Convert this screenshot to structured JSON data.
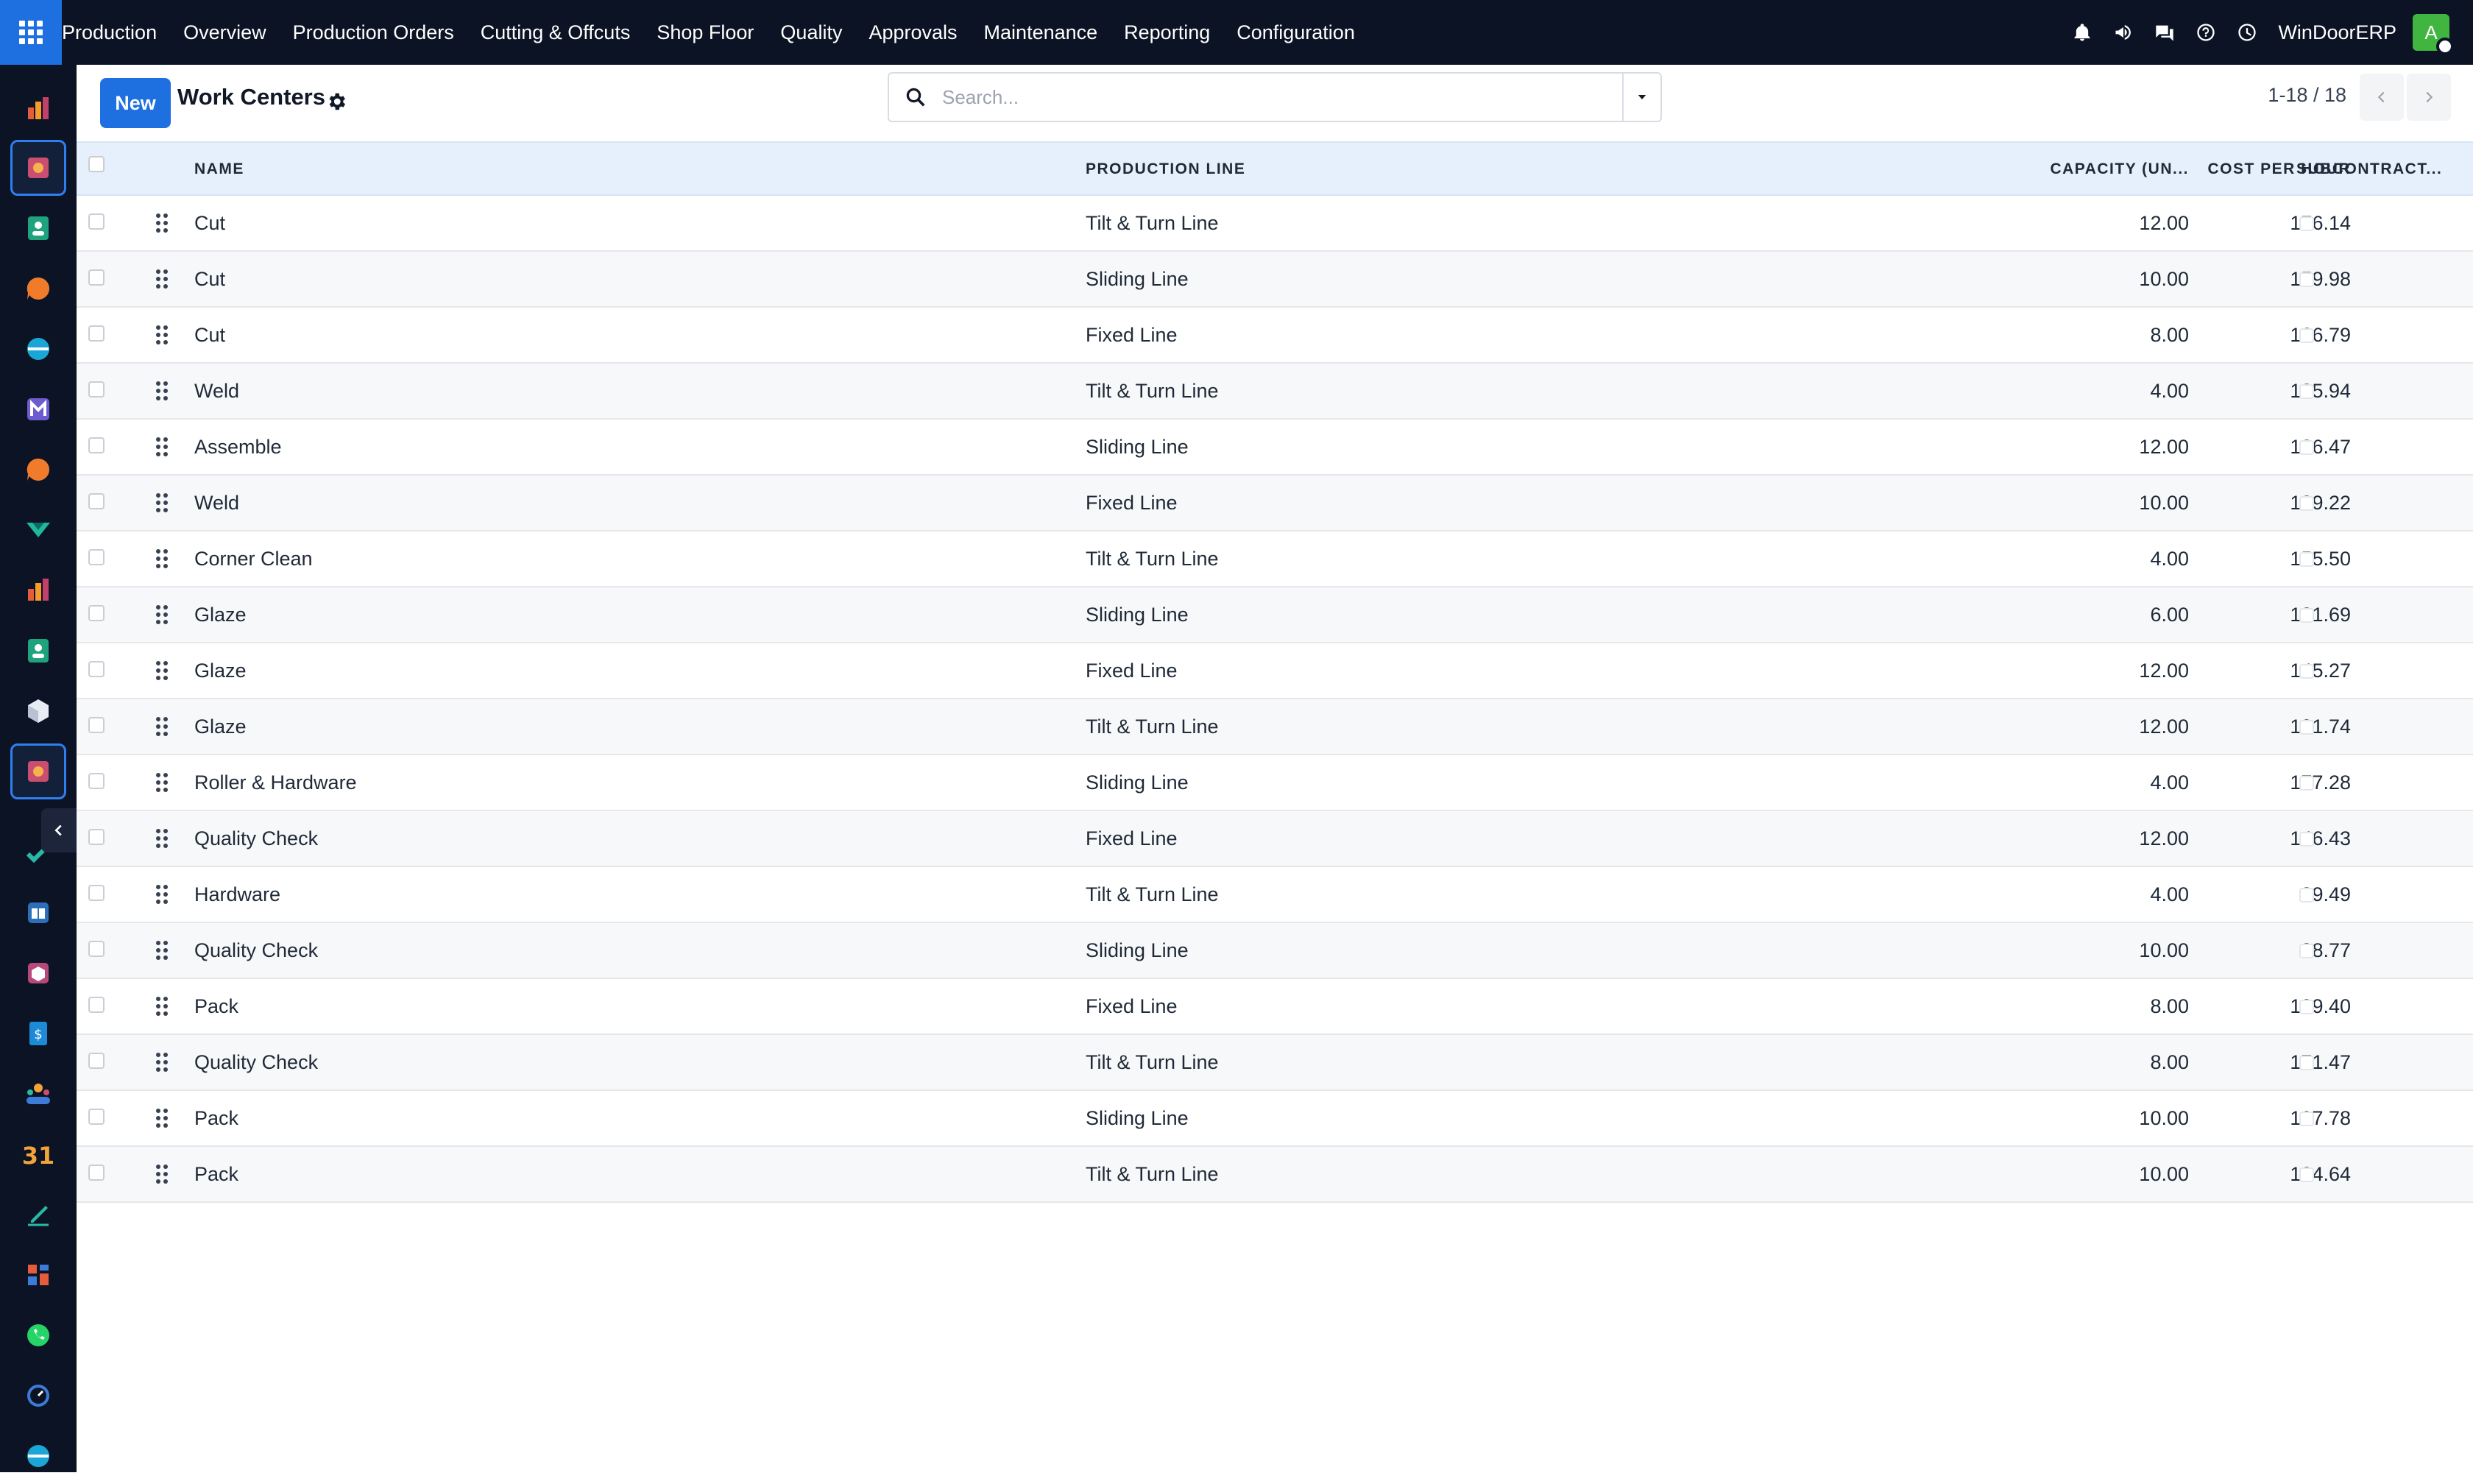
{
  "topbar": {
    "brand": "Production",
    "menu": [
      "Overview",
      "Production Orders",
      "Cutting & Offcuts",
      "Shop Floor",
      "Quality",
      "Approvals",
      "Maintenance",
      "Reporting",
      "Configuration"
    ],
    "company": "WinDoorERP",
    "avatar_initial": "A",
    "icons": [
      "bell-icon",
      "megaphone-icon",
      "chat-icon",
      "help-icon",
      "clock-icon"
    ]
  },
  "sidebar": {
    "apps": [
      "dashboards-app",
      "manufacturing-app",
      "contacts-app",
      "discuss-app",
      "planning-app",
      "mail-app",
      "discuss-app",
      "inventory-app",
      "dashboards-app",
      "contacts-app",
      "packages-app",
      "manufacturing-app",
      "project-app",
      "knowledge-app",
      "product-app",
      "invoicing-app",
      "employees-app",
      "calendar-app",
      "sign-app",
      "apps-dashboard-app",
      "whatsapp-app",
      "clock-app",
      "planning-app"
    ]
  },
  "control": {
    "new_label": "New",
    "title": "Work Centers",
    "search_placeholder": "Search...",
    "pager": "1-18 / 18"
  },
  "table": {
    "columns": {
      "name": "NAME",
      "line": "PRODUCTION LINE",
      "capacity": "CAPACITY (UN...",
      "cost": "COST PER HOUR",
      "subcontract": "SUBCONTRACT..."
    },
    "rows": [
      {
        "name": "Cut",
        "line": "Tilt & Turn Line",
        "capacity": "12.00",
        "cost": "176.14"
      },
      {
        "name": "Cut",
        "line": "Sliding Line",
        "capacity": "10.00",
        "cost": "159.98"
      },
      {
        "name": "Cut",
        "line": "Fixed Line",
        "capacity": "8.00",
        "cost": "166.79"
      },
      {
        "name": "Weld",
        "line": "Tilt & Turn Line",
        "capacity": "4.00",
        "cost": "125.94"
      },
      {
        "name": "Assemble",
        "line": "Sliding Line",
        "capacity": "12.00",
        "cost": "126.47"
      },
      {
        "name": "Weld",
        "line": "Fixed Line",
        "capacity": "10.00",
        "cost": "129.22"
      },
      {
        "name": "Corner Clean",
        "line": "Tilt & Turn Line",
        "capacity": "4.00",
        "cost": "155.50"
      },
      {
        "name": "Glaze",
        "line": "Sliding Line",
        "capacity": "6.00",
        "cost": "131.69"
      },
      {
        "name": "Glaze",
        "line": "Fixed Line",
        "capacity": "12.00",
        "cost": "145.27"
      },
      {
        "name": "Glaze",
        "line": "Tilt & Turn Line",
        "capacity": "12.00",
        "cost": "101.74"
      },
      {
        "name": "Roller & Hardware",
        "line": "Sliding Line",
        "capacity": "4.00",
        "cost": "177.28"
      },
      {
        "name": "Quality Check",
        "line": "Fixed Line",
        "capacity": "12.00",
        "cost": "146.43"
      },
      {
        "name": "Hardware",
        "line": "Tilt & Turn Line",
        "capacity": "4.00",
        "cost": "89.49"
      },
      {
        "name": "Quality Check",
        "line": "Sliding Line",
        "capacity": "10.00",
        "cost": "88.77"
      },
      {
        "name": "Pack",
        "line": "Fixed Line",
        "capacity": "8.00",
        "cost": "109.40"
      },
      {
        "name": "Quality Check",
        "line": "Tilt & Turn Line",
        "capacity": "8.00",
        "cost": "171.47"
      },
      {
        "name": "Pack",
        "line": "Sliding Line",
        "capacity": "10.00",
        "cost": "107.78"
      },
      {
        "name": "Pack",
        "line": "Tilt & Turn Line",
        "capacity": "10.00",
        "cost": "134.64"
      }
    ]
  },
  "colors": {
    "navbar": "#0b1324",
    "accent": "#1e6fe0",
    "header_row": "#e6f0fc",
    "avatar": "#40b640"
  }
}
